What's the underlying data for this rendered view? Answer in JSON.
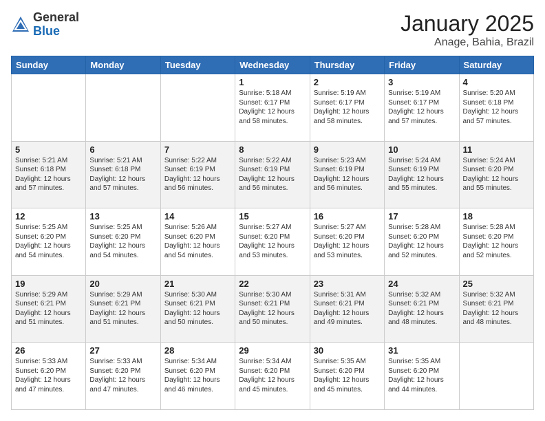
{
  "logo": {
    "text_general": "General",
    "text_blue": "Blue"
  },
  "header": {
    "month": "January 2025",
    "location": "Anage, Bahia, Brazil"
  },
  "weekdays": [
    "Sunday",
    "Monday",
    "Tuesday",
    "Wednesday",
    "Thursday",
    "Friday",
    "Saturday"
  ],
  "weeks": [
    [
      {
        "date": "",
        "info": ""
      },
      {
        "date": "",
        "info": ""
      },
      {
        "date": "",
        "info": ""
      },
      {
        "date": "1",
        "info": "Sunrise: 5:18 AM\nSunset: 6:17 PM\nDaylight: 12 hours\nand 58 minutes."
      },
      {
        "date": "2",
        "info": "Sunrise: 5:19 AM\nSunset: 6:17 PM\nDaylight: 12 hours\nand 58 minutes."
      },
      {
        "date": "3",
        "info": "Sunrise: 5:19 AM\nSunset: 6:17 PM\nDaylight: 12 hours\nand 57 minutes."
      },
      {
        "date": "4",
        "info": "Sunrise: 5:20 AM\nSunset: 6:18 PM\nDaylight: 12 hours\nand 57 minutes."
      }
    ],
    [
      {
        "date": "5",
        "info": "Sunrise: 5:21 AM\nSunset: 6:18 PM\nDaylight: 12 hours\nand 57 minutes."
      },
      {
        "date": "6",
        "info": "Sunrise: 5:21 AM\nSunset: 6:18 PM\nDaylight: 12 hours\nand 57 minutes."
      },
      {
        "date": "7",
        "info": "Sunrise: 5:22 AM\nSunset: 6:19 PM\nDaylight: 12 hours\nand 56 minutes."
      },
      {
        "date": "8",
        "info": "Sunrise: 5:22 AM\nSunset: 6:19 PM\nDaylight: 12 hours\nand 56 minutes."
      },
      {
        "date": "9",
        "info": "Sunrise: 5:23 AM\nSunset: 6:19 PM\nDaylight: 12 hours\nand 56 minutes."
      },
      {
        "date": "10",
        "info": "Sunrise: 5:24 AM\nSunset: 6:19 PM\nDaylight: 12 hours\nand 55 minutes."
      },
      {
        "date": "11",
        "info": "Sunrise: 5:24 AM\nSunset: 6:20 PM\nDaylight: 12 hours\nand 55 minutes."
      }
    ],
    [
      {
        "date": "12",
        "info": "Sunrise: 5:25 AM\nSunset: 6:20 PM\nDaylight: 12 hours\nand 54 minutes."
      },
      {
        "date": "13",
        "info": "Sunrise: 5:25 AM\nSunset: 6:20 PM\nDaylight: 12 hours\nand 54 minutes."
      },
      {
        "date": "14",
        "info": "Sunrise: 5:26 AM\nSunset: 6:20 PM\nDaylight: 12 hours\nand 54 minutes."
      },
      {
        "date": "15",
        "info": "Sunrise: 5:27 AM\nSunset: 6:20 PM\nDaylight: 12 hours\nand 53 minutes."
      },
      {
        "date": "16",
        "info": "Sunrise: 5:27 AM\nSunset: 6:20 PM\nDaylight: 12 hours\nand 53 minutes."
      },
      {
        "date": "17",
        "info": "Sunrise: 5:28 AM\nSunset: 6:20 PM\nDaylight: 12 hours\nand 52 minutes."
      },
      {
        "date": "18",
        "info": "Sunrise: 5:28 AM\nSunset: 6:20 PM\nDaylight: 12 hours\nand 52 minutes."
      }
    ],
    [
      {
        "date": "19",
        "info": "Sunrise: 5:29 AM\nSunset: 6:21 PM\nDaylight: 12 hours\nand 51 minutes."
      },
      {
        "date": "20",
        "info": "Sunrise: 5:29 AM\nSunset: 6:21 PM\nDaylight: 12 hours\nand 51 minutes."
      },
      {
        "date": "21",
        "info": "Sunrise: 5:30 AM\nSunset: 6:21 PM\nDaylight: 12 hours\nand 50 minutes."
      },
      {
        "date": "22",
        "info": "Sunrise: 5:30 AM\nSunset: 6:21 PM\nDaylight: 12 hours\nand 50 minutes."
      },
      {
        "date": "23",
        "info": "Sunrise: 5:31 AM\nSunset: 6:21 PM\nDaylight: 12 hours\nand 49 minutes."
      },
      {
        "date": "24",
        "info": "Sunrise: 5:32 AM\nSunset: 6:21 PM\nDaylight: 12 hours\nand 48 minutes."
      },
      {
        "date": "25",
        "info": "Sunrise: 5:32 AM\nSunset: 6:21 PM\nDaylight: 12 hours\nand 48 minutes."
      }
    ],
    [
      {
        "date": "26",
        "info": "Sunrise: 5:33 AM\nSunset: 6:20 PM\nDaylight: 12 hours\nand 47 minutes."
      },
      {
        "date": "27",
        "info": "Sunrise: 5:33 AM\nSunset: 6:20 PM\nDaylight: 12 hours\nand 47 minutes."
      },
      {
        "date": "28",
        "info": "Sunrise: 5:34 AM\nSunset: 6:20 PM\nDaylight: 12 hours\nand 46 minutes."
      },
      {
        "date": "29",
        "info": "Sunrise: 5:34 AM\nSunset: 6:20 PM\nDaylight: 12 hours\nand 45 minutes."
      },
      {
        "date": "30",
        "info": "Sunrise: 5:35 AM\nSunset: 6:20 PM\nDaylight: 12 hours\nand 45 minutes."
      },
      {
        "date": "31",
        "info": "Sunrise: 5:35 AM\nSunset: 6:20 PM\nDaylight: 12 hours\nand 44 minutes."
      },
      {
        "date": "",
        "info": ""
      }
    ]
  ]
}
